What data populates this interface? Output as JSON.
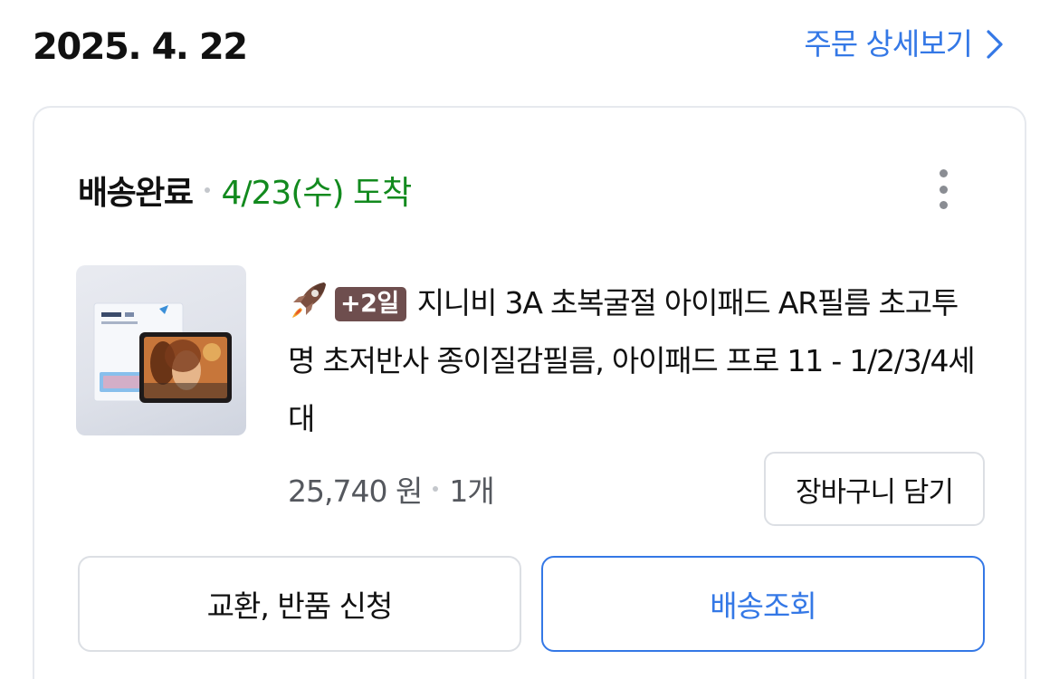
{
  "header": {
    "order_date": "2025. 4. 22",
    "detail_link_label": "주문 상세보기"
  },
  "order_card": {
    "status": "배송완료",
    "arrival": "4/23(수) 도착",
    "product": {
      "badge": "+2일",
      "badge_icon": "rocket-icon",
      "name": "지니비 3A 초복굴절 아이패드 AR필름 초고투명 초저반사 종이질감필름, 아이패드 프로 11 - 1/2/3/4세대",
      "price": "25,740 원",
      "quantity": "1개"
    },
    "cart_button_label": "장바구니 담기",
    "exchange_button_label": "교환, 반품 신청",
    "track_button_label": "배송조회"
  },
  "colors": {
    "accent_blue": "#3478e6",
    "arrival_green": "#128a1e",
    "badge_brown": "#6e4e4e"
  }
}
